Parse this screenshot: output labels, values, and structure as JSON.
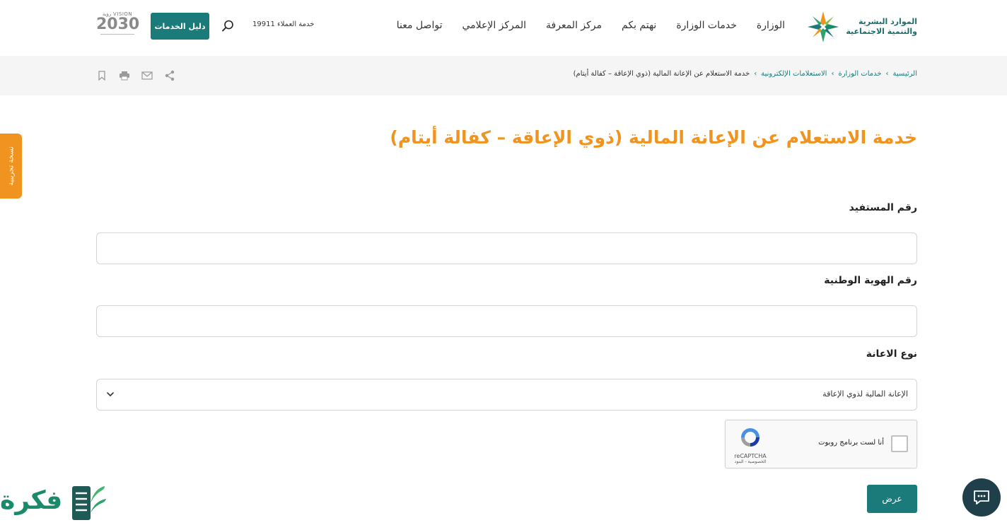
{
  "header": {
    "logo_line1": "الموارد البشرية",
    "logo_line2": "والتنمية الاجتماعية",
    "nav": [
      "الوزارة",
      "خدمات الوزارة",
      "نهتم بكم",
      "مركز المعرفة",
      "المركز الإعلامي",
      "تواصل معنا"
    ],
    "customer_service": "خدمة العملاء 19911",
    "services_guide": "دليل الخدمات",
    "vision_top": "VISION رؤية",
    "vision_year": "2030"
  },
  "breadcrumb": {
    "items": [
      "الرئيسية",
      "خدمات الوزارة",
      "الاستعلامات الإلكترونية"
    ],
    "current": "خدمة الاستعلام عن الإعانة المالية (ذوي الإعاقة – كفالة أيتام)"
  },
  "side_tab": "نسخة تجريبية",
  "page_title": "خدمة الاستعلام عن الإعانة المالية (ذوي الإعاقة – كفالة أيتام)",
  "form": {
    "beneficiary_label": "رقم المستفيد",
    "beneficiary_value": "",
    "national_id_label": "رقم الهوية الوطنية",
    "national_id_value": "",
    "aid_type_label": "نوع الاعانة",
    "aid_type_value": "الإعانة المالية لذوي الإعاقة",
    "captcha_text": "أنا لست برنامج روبوت",
    "captcha_brand": "reCAPTCHA",
    "captcha_links": "الخصوصية - البنود",
    "submit_label": "عرض"
  },
  "watermark_text": "فكرة",
  "colors": {
    "accent_teal": "#1b7b7a",
    "title_orange": "#f0941f",
    "chat_dark": "#1f3f4a"
  },
  "icons": [
    "search-icon",
    "bookmark-icon",
    "print-icon",
    "mail-icon",
    "share-icon",
    "chevron-down-icon",
    "chat-icon",
    "recaptcha-icon"
  ]
}
